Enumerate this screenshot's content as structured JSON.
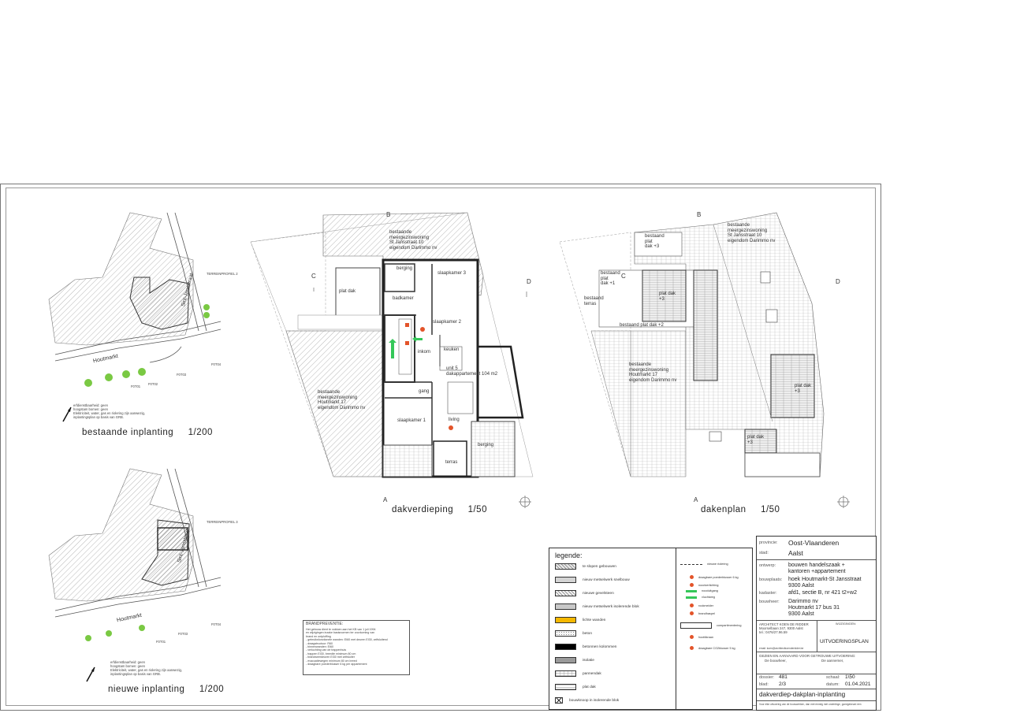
{
  "views": {
    "existing_site": {
      "title": "bestaande inplanting",
      "scale": "1/200"
    },
    "new_site": {
      "title": "nieuwe inplanting",
      "scale": "1/200"
    },
    "attic_floor": {
      "title": "dakverdieping",
      "scale": "1/50"
    },
    "roof_plan": {
      "title": "dakenplan",
      "scale": "1/50"
    }
  },
  "site_labels": {
    "street_a": "Houtmarkt",
    "street_b": "Sint-Jansstraat",
    "profile_1": "TERREINPROFIEL 2",
    "profile_2": "TERREINPROFIEL 3",
    "f1": "F0T01",
    "f2": "F0T02",
    "f3": "F0T03",
    "f4": "F0T04",
    "note_existing": "erfdienstbaarheid: geen\nhoogstam bomen: geen\nElektriciteit, water, gas en riolering zijn aanwezig,\ninplantingsplan op basis van GRB.",
    "note_new": "erfdienstbaarheid: geen\nhoogstam bomen: geen\nElektriciteit, water, gas en riolering zijn aanwezig,\ninplantingsplan op basis van GRB."
  },
  "attic_labels": {
    "neighbour_top": "bestaande\nmeergezinswoning\nSt Jansstraat 10\neigendom Darimmo nv",
    "neighbour_bottom": "bestaande\nmeergezinswoning\nHoutmarkt 17\neigendom Darimmo nv",
    "plat_dak": "plat dak",
    "berging": "berging",
    "slaapkamer_3": "slaapkamer 3",
    "badkamer": "badkamer",
    "slaapkamer_2": "slaapkamer 2",
    "inkom": "inkom",
    "keuken": "keuken",
    "unit": "unit 5\ndakappartement 104 m2",
    "gang": "gang",
    "slaapkamer_1": "slaapkamer 1",
    "living": "living",
    "berging_2": "berging",
    "terras": "terras",
    "section_b": "B",
    "section_c": "C",
    "section_d": "D",
    "section_a": "A"
  },
  "roof_labels": {
    "neighbour_top": "bestaande\nmeergezinswoning\nSt Jansstraat 10\neigendom Darimmo nv",
    "neighbour_bottom": "bestaande\nmeergezinswoning\nHoutmarkt 17\neigendom Darimmo nv",
    "plat_dak_3": "bestaand\nplat\ndak +3",
    "plat_dak_1": "bestaand\nplat\ndak +1",
    "terras": "bestaand\nterras",
    "plat_dak_2": "bestaand plat dak +2",
    "plat_dak_a": "plat dak\n+3",
    "plat_dak_b": "plat dak\n+3",
    "plat_dak_c": "plat dak\n+3",
    "section_b": "B",
    "section_c": "C",
    "section_d": "D",
    "section_a": "A"
  },
  "legend": {
    "heading": "legende:",
    "items": [
      {
        "label": "te slopen gebouwen",
        "fill": "#e8e8e8",
        "pattern": "hatch"
      },
      {
        "label": "nieuw metselwerk snelbouw",
        "fill": "#d4d4d4",
        "pattern": "none"
      },
      {
        "label": "nieuwe gevelsteen",
        "fill": "#f2f2f2",
        "pattern": "hatch"
      },
      {
        "label": "nieuw metselwerk isolerende blok",
        "fill": "#c8c8c8",
        "pattern": "none"
      },
      {
        "label": "lichte wanden",
        "fill": "#f5b800",
        "pattern": "none"
      },
      {
        "label": "beton",
        "fill": "#f7f7f7",
        "pattern": "dots"
      },
      {
        "label": "betonnen kolommen",
        "fill": "#000000",
        "pattern": "none"
      },
      {
        "label": "isolatie",
        "fill": "#9a9a9a",
        "pattern": "none"
      },
      {
        "label": "pannendak",
        "fill": "#ffffff",
        "pattern": "tiles"
      },
      {
        "label": "plat dak",
        "fill": "#ffffff",
        "pattern": "lines"
      },
      {
        "label": "bouwknoop in isolerende blok",
        "fill": "#ffffff",
        "pattern": "cross"
      }
    ],
    "right_items": [
      "nieuwe riolering",
      "draagbare poederblusser 6 kg",
      "noodverlichting",
      "nooduitgang",
      "vluchtweg",
      "rookmelder",
      "brandhaspel",
      "compartimentering",
      "hoofdkraan",
      "draagbare CO2blusser 5 kg"
    ]
  },
  "fire_note": {
    "heading": "BRANDPREVENTIE:",
    "text": "Het gebouw dient te voldoen aan het KB van 1 juli 1994\nen wijzigingen inzake basisnormen ter voorkoming van\nbrand en ontploffing\n- gebruiksfunctionele wanden: EI60 met deuren EI30, zelfsluitend\n- draagstructuur: R60\n- binnenwanden: EI60\n- verluchting van de trappenhuis\n- trappen EI30, breedte minimum 80 cm\n- brandweerdeuren EI30 met zelfsluiter\n- evacuatiewegen minimum 80 cm breed\n- draagbare poederblusser 6 kg per appartement"
  },
  "title_block": {
    "provincie_key": "provincie:",
    "provincie": "Oost-Vlaanderen",
    "stad_key": "stad:",
    "stad": "Aalst",
    "ontwerp_key": "ontwerp:",
    "ontwerp": "bouwen handelszaak +\nkantoren +appartement",
    "bouwplaats_key": "bouwplaats:",
    "bouwplaats": "hoek Houtmarkt-St Jansstraat\n9300 Aalst",
    "kadaster_key": "kadaster:",
    "kadaster": "afd1, sectie B, nr 421 t2+w2",
    "bouwheer_key": "bouwheer:",
    "bouwheer": "Darimmo nv\nHoutmarkt 17 bus 31\n9300 Aalst",
    "architect": "ARCHITECT KOEN DE RIDDER\nMoorselbaan 247, 9300 Aalst\ntel.: 0476/27.96.59",
    "email": "email: koen@architectkoenderidder.be",
    "wijzigingen_key": "WIJZIGINGEN:",
    "plan_type": "UITVOERINGSPLAN",
    "agreement": "GEZIEN EN AANVAARD VOOR GETROUWE UITVOERING:",
    "bouwheer_sign": "De bouwheer,",
    "aannemer_sign": "De aannemer,",
    "dossier_key": "dossier:",
    "dossier": "481",
    "schaal_key": "schaal:",
    "schaal": "1\\50",
    "blad_key": "blad:",
    "blad": "2/3",
    "datum_key": "datum:",
    "datum": "01.04.2021",
    "drawing_title": "dakverdiep-dakplan-inplanting",
    "disclaimer": "Voor elke uitvoering van de bouwwerken, dan met ernstig met onderlinge, goedgekeurd een"
  },
  "colors": {
    "hatch": "#777777",
    "wall": "#3a3a3a",
    "accent_orange": "#e3542a",
    "accent_green": "#35c759",
    "tree_green": "#7ac943"
  }
}
